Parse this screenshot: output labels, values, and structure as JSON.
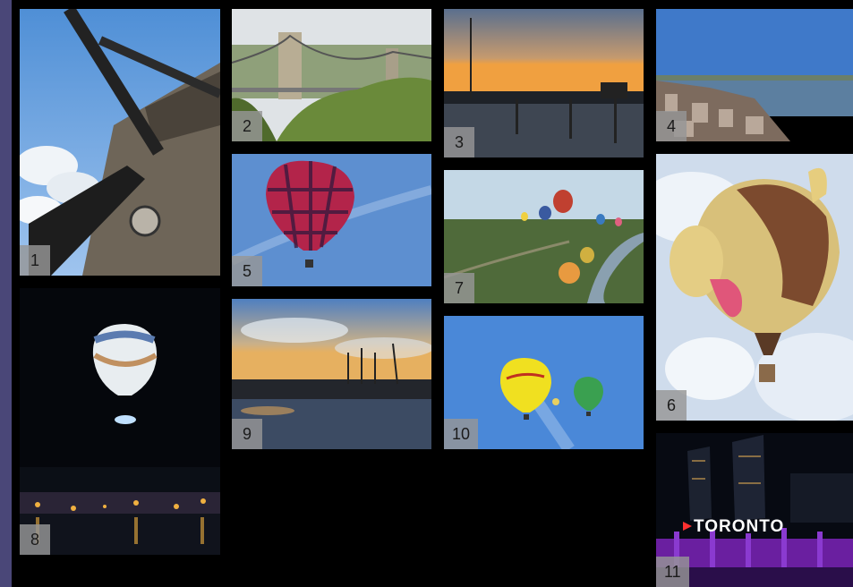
{
  "gallery": {
    "tiles": [
      {
        "number": "1",
        "icon": "windmill-photo"
      },
      {
        "number": "2",
        "icon": "suspension-bridge-photo"
      },
      {
        "number": "3",
        "icon": "marina-sunset-photo"
      },
      {
        "number": "4",
        "icon": "coastal-city-photo"
      },
      {
        "number": "5",
        "icon": "red-balloon-photo"
      },
      {
        "number": "6",
        "icon": "dog-balloon-photo"
      },
      {
        "number": "7",
        "icon": "balloon-festival-aerial-photo"
      },
      {
        "number": "8",
        "icon": "night-balloon-photo"
      },
      {
        "number": "9",
        "icon": "harbour-sunset-photo"
      },
      {
        "number": "10",
        "icon": "yellow-and-green-balloons-photo"
      },
      {
        "number": "11",
        "icon": "toronto-sign-photo"
      }
    ],
    "toronto_sign_text": "TORONTO"
  },
  "colors": {
    "page_background": "#4a4778",
    "grid_background": "#000000",
    "label_background": "#969696"
  }
}
